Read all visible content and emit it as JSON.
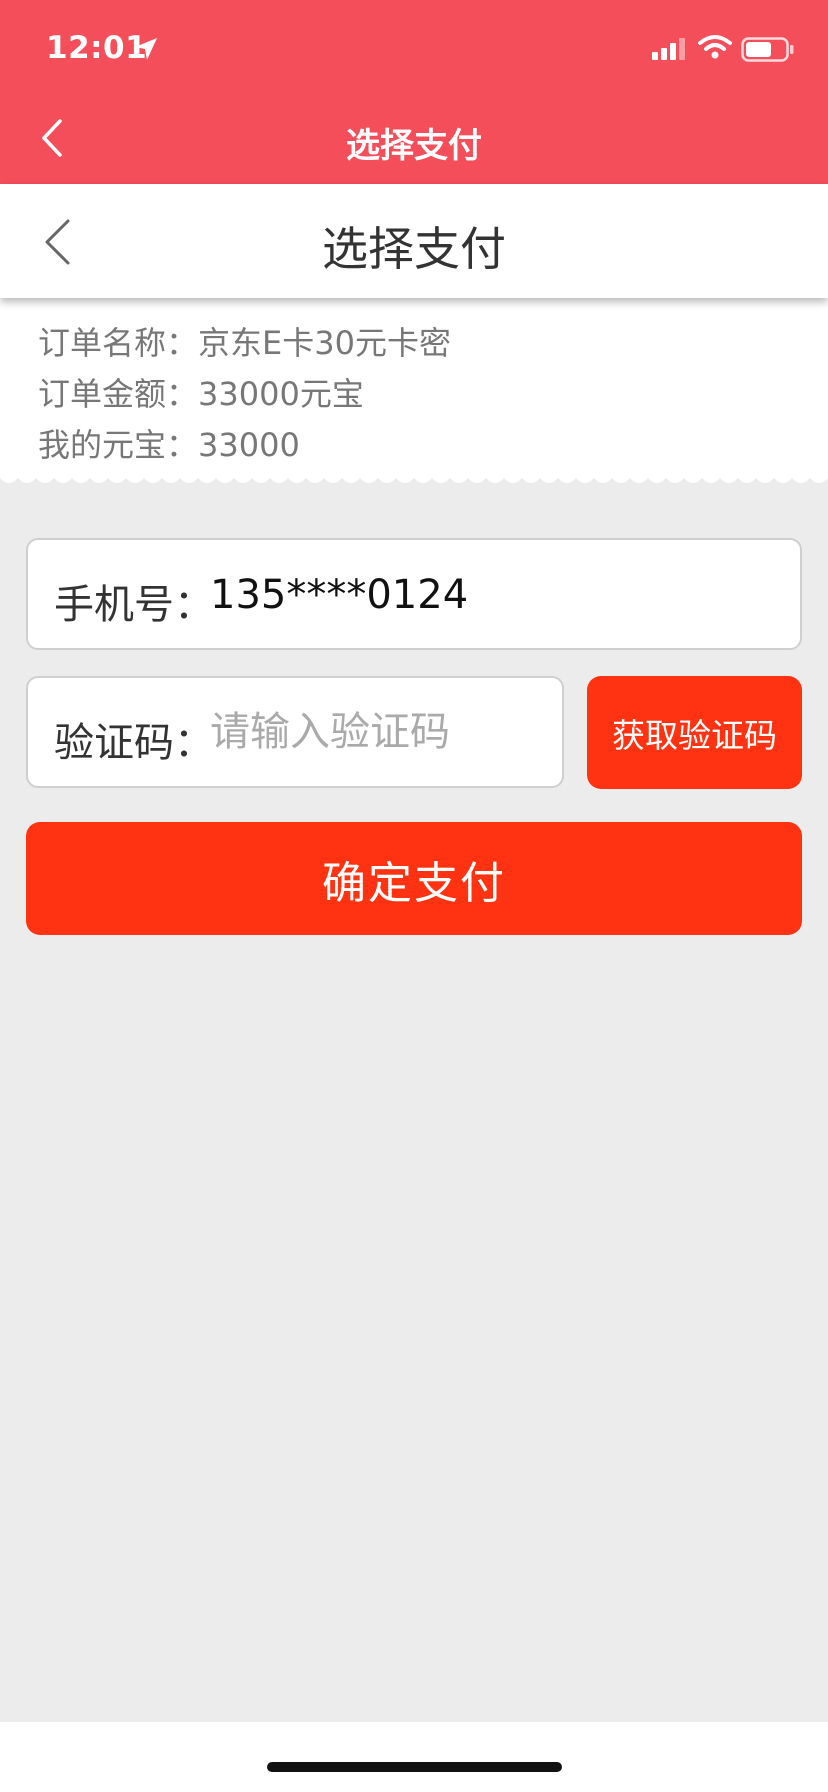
{
  "status_bar": {
    "time": "12:01",
    "icons": [
      "location-arrow-icon",
      "signal-icon",
      "wifi-icon",
      "battery-icon"
    ]
  },
  "nav": {
    "title": "选择支付",
    "back_icon": "chevron-left-icon"
  },
  "header": {
    "title": "选择支付",
    "back_icon": "chevron-left-icon"
  },
  "order": {
    "name_label": "订单名称：",
    "name_value": "京东E卡30元卡密",
    "amount_label": "订单金额：",
    "amount_value": "33000元宝",
    "balance_label": "我的元宝：",
    "balance_value": "33000"
  },
  "form": {
    "phone_label": "手机号：",
    "phone_value": "135****0124",
    "code_label": "验证码：",
    "code_placeholder": "请输入验证码",
    "get_code_label": "获取验证码",
    "confirm_label": "确定支付"
  },
  "colors": {
    "top_bar": "#f44e5b",
    "primary_button": "#ff3312",
    "background": "#ececec"
  }
}
